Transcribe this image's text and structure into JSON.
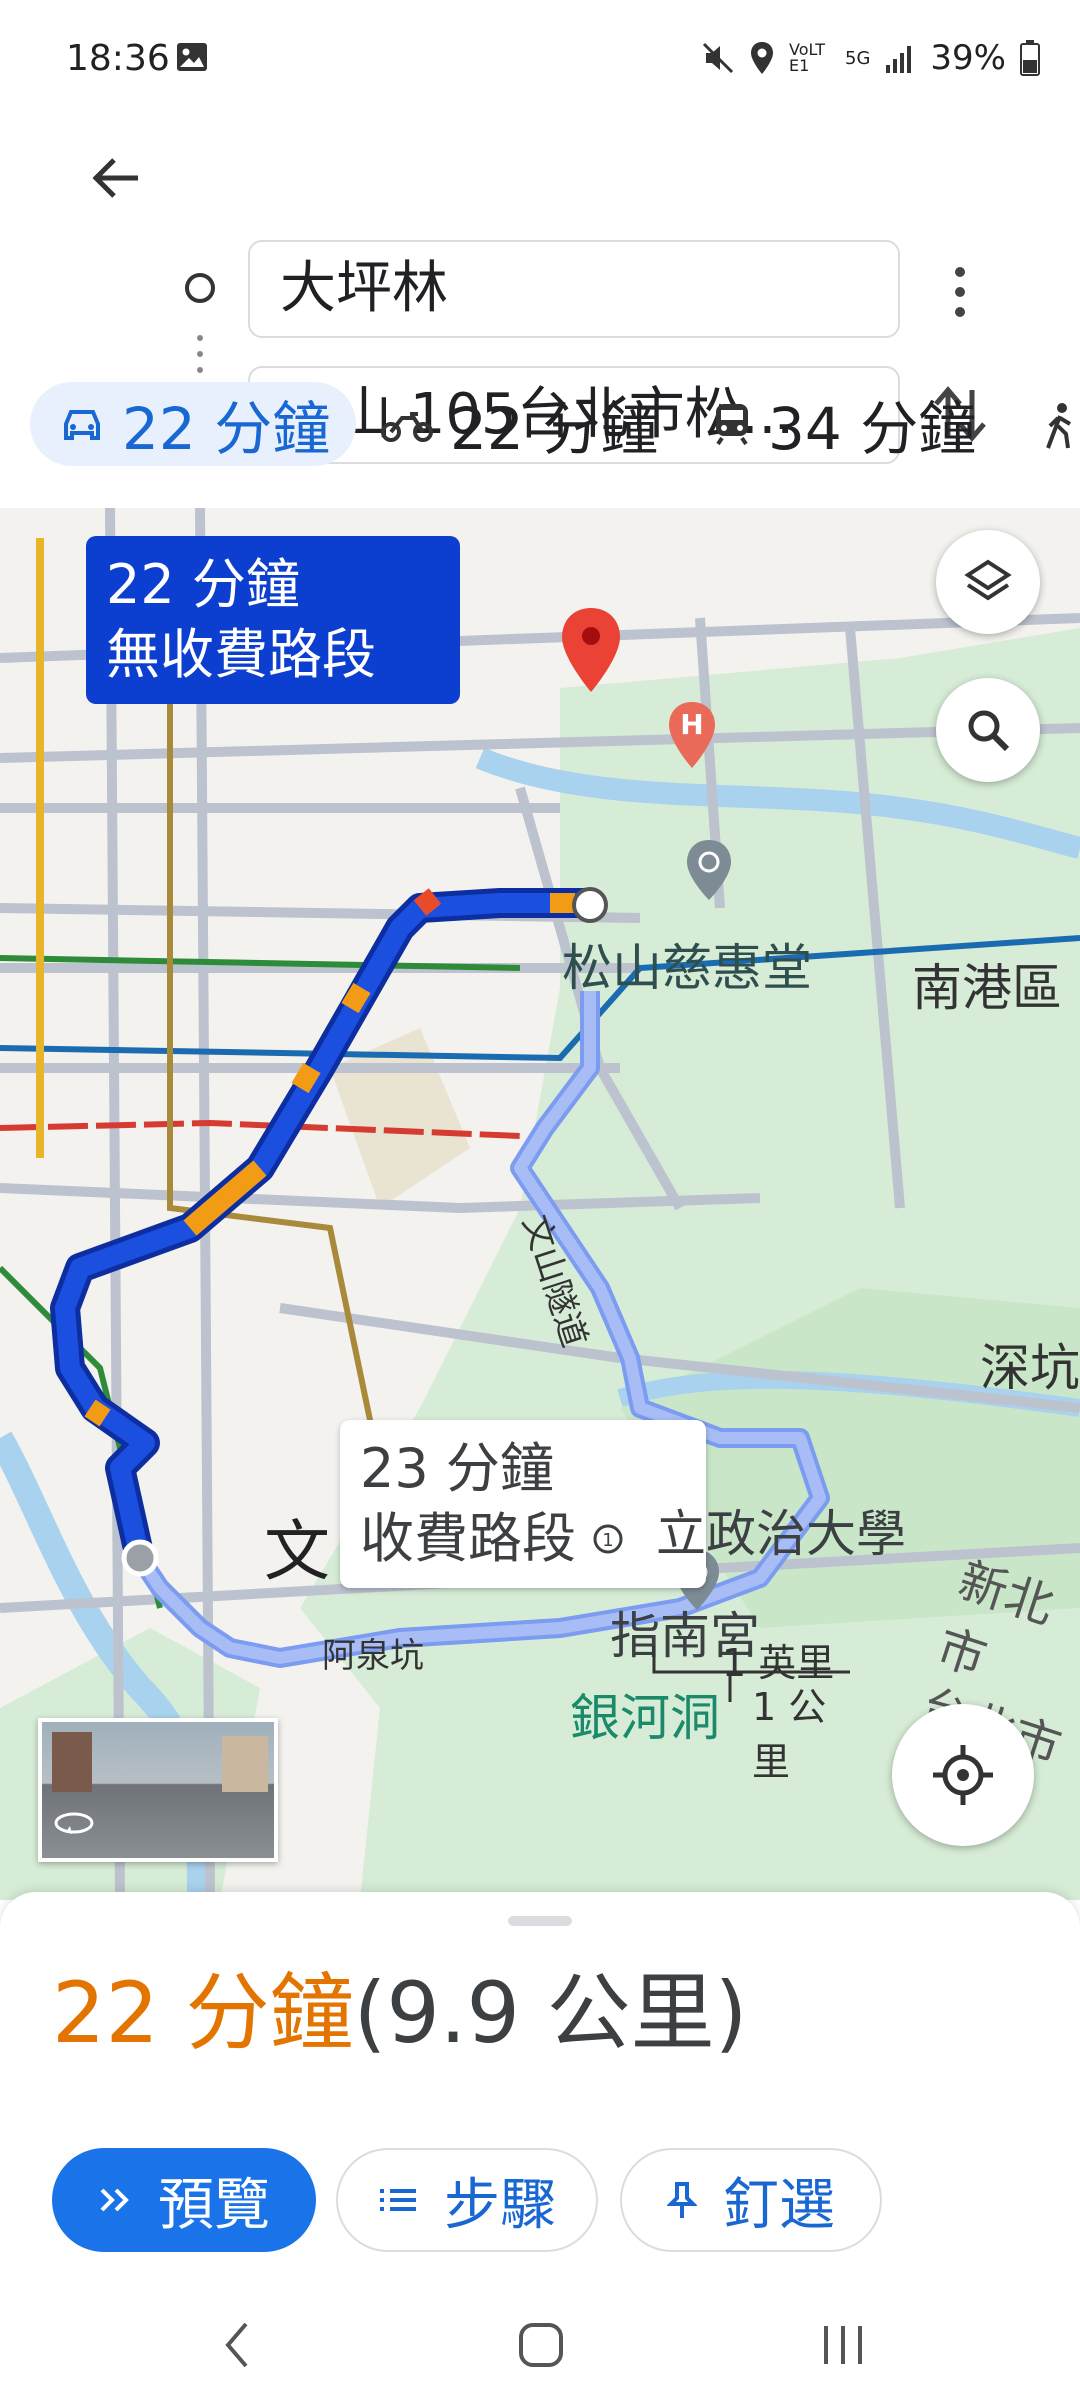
{
  "status_bar": {
    "time": "18:36",
    "network": "VoLTE1",
    "signal": "5G",
    "battery": "39%"
  },
  "search": {
    "origin": "大坪林",
    "destination": "松山 105台北市松..."
  },
  "modes": [
    {
      "icon": "car-icon",
      "label": "22 分鐘",
      "selected": true
    },
    {
      "icon": "motorcycle-icon",
      "label": "22 分鐘",
      "selected": false
    },
    {
      "icon": "transit-icon",
      "label": "34 分鐘",
      "selected": false
    }
  ],
  "map": {
    "primary_route": {
      "time": "22 分鐘",
      "note": "無收費路段"
    },
    "alt_route": {
      "time": "23 分鐘",
      "note": "收費路段"
    },
    "labels": {
      "songshan_cihui": "松山慈惠堂",
      "nangang": "南港區",
      "shenkeng": "深坑",
      "nccu": "立政治大學",
      "xinbei": "新北市",
      "zhinan": "指南宮",
      "yinhe": "銀河洞",
      "aquankeng": "阿泉坑",
      "wenshan_tunnel": "文山隧道",
      "wen": "文",
      "taipei": "台北市"
    },
    "scale": {
      "miles": "1 英里",
      "km": "1 公里"
    }
  },
  "summary": {
    "duration": "22 分鐘",
    "distance": "(9.9 公里)"
  },
  "actions": {
    "preview": "預覽",
    "steps": "步驟",
    "pin": "釘選"
  },
  "colors": {
    "accent": "#1a73e8",
    "route": "#1a4fe0",
    "eta": "#e37400"
  }
}
